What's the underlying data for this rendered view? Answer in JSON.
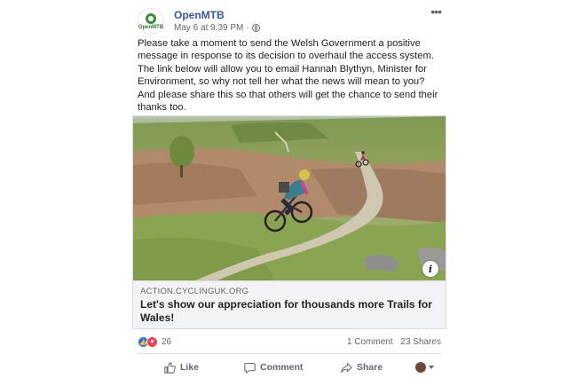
{
  "post": {
    "page_name": "OpenMTB",
    "avatar_text": "OpenMTB",
    "timestamp": "May 6 at 9:39 PM",
    "separator": "·",
    "more_label": "•••",
    "message": "Please take a moment to send the Welsh Government a positive message in response to its decision to overhaul the access system. The link below will allow you to email Hannah Blythyn, Minister for Environment, so why not tell her what the news will mean to you? And please share this so that others will get the chance to send their thanks too."
  },
  "link": {
    "domain": "ACTION.CYCLINGUK.ORG",
    "title": "Let's show our appreciation for thousands more Trails for Wales!",
    "info_label": "i"
  },
  "stats": {
    "reaction_count": "26",
    "comments": "1 Comment",
    "shares": "23 Shares"
  },
  "actions": {
    "like": "Like",
    "comment": "Comment",
    "share": "Share"
  },
  "colors": {
    "page_name": "#365899",
    "like_blue": "#1877f2",
    "love_red": "#f33e58",
    "link_meta_bg": "#f2f3f5"
  }
}
